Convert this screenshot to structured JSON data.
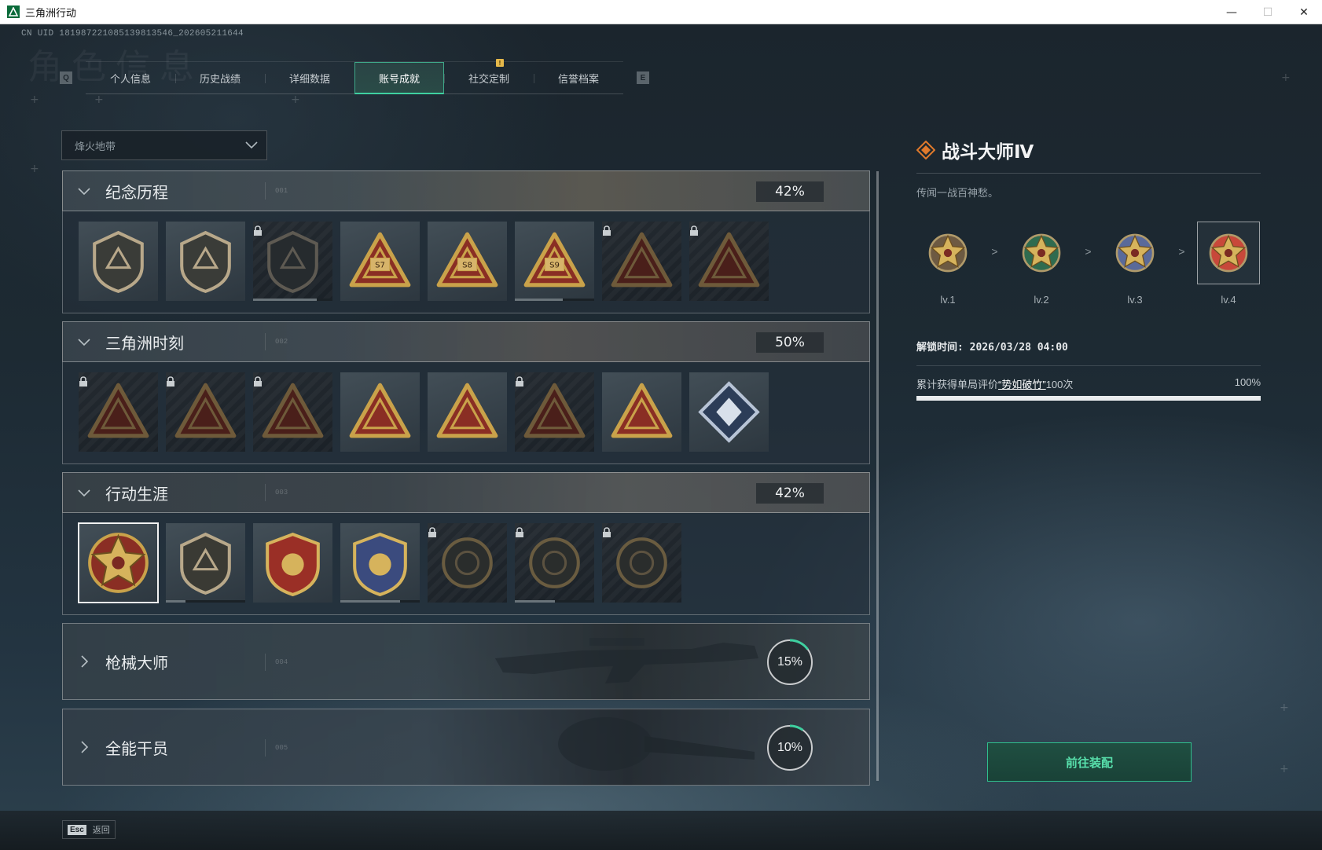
{
  "window": {
    "title": "三角洲行动",
    "minimize": "—",
    "maximize": "☐",
    "close": "✕"
  },
  "uid": "CN UID 181987221085139813546_202605211644",
  "background_watermark": "角色信息",
  "tabs": {
    "prev_key": "Q",
    "next_key": "E",
    "items": [
      {
        "label": "个人信息",
        "active": false
      },
      {
        "label": "历史战绩",
        "active": false
      },
      {
        "label": "详细数据",
        "active": false
      },
      {
        "label": "账号成就",
        "active": true
      },
      {
        "label": "社交定制",
        "active": false,
        "alert": "!"
      },
      {
        "label": "信誉档案",
        "active": false
      }
    ]
  },
  "mode_select": {
    "value": "烽火地带"
  },
  "sections": [
    {
      "title": "纪念历程",
      "code": "001",
      "progress": "42%",
      "expanded": true,
      "badges": [
        {
          "icon": "peak-shield-icon",
          "locked": false
        },
        {
          "icon": "helicopter-badge-icon",
          "locked": false
        },
        {
          "icon": "dark-hex-emblem-icon",
          "locked": true,
          "progress": 0.8
        },
        {
          "icon": "season-s7-badge-icon",
          "locked": false,
          "text": "S7"
        },
        {
          "icon": "season-s8-badge-icon",
          "locked": false,
          "text": "S8"
        },
        {
          "icon": "season-s9-badge-icon",
          "locked": false,
          "text": "S9",
          "progress": 0.6
        },
        {
          "icon": "hooded-operator-badge-icon",
          "locked": true
        },
        {
          "icon": "skull-crossbones-badge-icon",
          "locked": true
        }
      ]
    },
    {
      "title": "三角洲时刻",
      "code": "002",
      "progress": "50%",
      "expanded": true,
      "badges": [
        {
          "icon": "backpack-badge-icon",
          "locked": true
        },
        {
          "icon": "vest-badge-icon",
          "locked": true
        },
        {
          "icon": "kneeling-soldier-badge-icon",
          "locked": true
        },
        {
          "icon": "polyhedron-hands-badge-icon",
          "locked": false
        },
        {
          "icon": "squad-badge-icon",
          "locked": false
        },
        {
          "icon": "team-rescue-badge-icon",
          "locked": true
        },
        {
          "icon": "fish-badge-icon",
          "locked": false
        },
        {
          "icon": "diamond-hands-badge-icon",
          "locked": false
        }
      ]
    },
    {
      "title": "行动生涯",
      "code": "003",
      "progress": "42%",
      "expanded": true,
      "badges": [
        {
          "icon": "combat-master-star-badge-icon",
          "locked": false,
          "selected": true
        },
        {
          "icon": "shield-wings-badge-icon",
          "locked": false,
          "progress": 0.25
        },
        {
          "icon": "red-gold-medal-badge-icon",
          "locked": false
        },
        {
          "icon": "blue-diamond-medal-badge-icon",
          "locked": false,
          "progress": 0.75
        },
        {
          "icon": "scarab-coin-badge-icon",
          "locked": true
        },
        {
          "icon": "skull-coin-badge-icon",
          "locked": true,
          "progress": 0.5
        },
        {
          "icon": "eye-coin-badge-icon",
          "locked": true
        }
      ]
    },
    {
      "title": "枪械大师",
      "code": "004",
      "progress": "15%",
      "ring": 0.15,
      "expanded": false
    },
    {
      "title": "全能干员",
      "code": "005",
      "progress": "10%",
      "ring": 0.1,
      "expanded": false
    }
  ],
  "detail": {
    "title": "战斗大师Ⅳ",
    "description": "传闻一战百神愁。",
    "levels": [
      {
        "label": "lv.1",
        "color": "#6d5a42"
      },
      {
        "label": "lv.2",
        "color": "#2f6b4f"
      },
      {
        "label": "lv.3",
        "color": "#5a6a9a"
      },
      {
        "label": "lv.4",
        "color": "#c8483a",
        "current": true
      }
    ],
    "level_arrow": ">",
    "unlock_time": "解锁时间: 2026/03/28 04:00",
    "task_prefix": "累计获得单局评价",
    "task_highlight": "“势如破竹”",
    "task_suffix": "100次",
    "task_percent": "100%",
    "task_progress": 1.0
  },
  "equip_button": "前往装配",
  "footer": {
    "esc_key": "Esc",
    "esc_label": "返回"
  },
  "colors": {
    "accent": "#3fd0a0",
    "gold": "#c9a24a",
    "badge_red": "#8a2e24"
  }
}
